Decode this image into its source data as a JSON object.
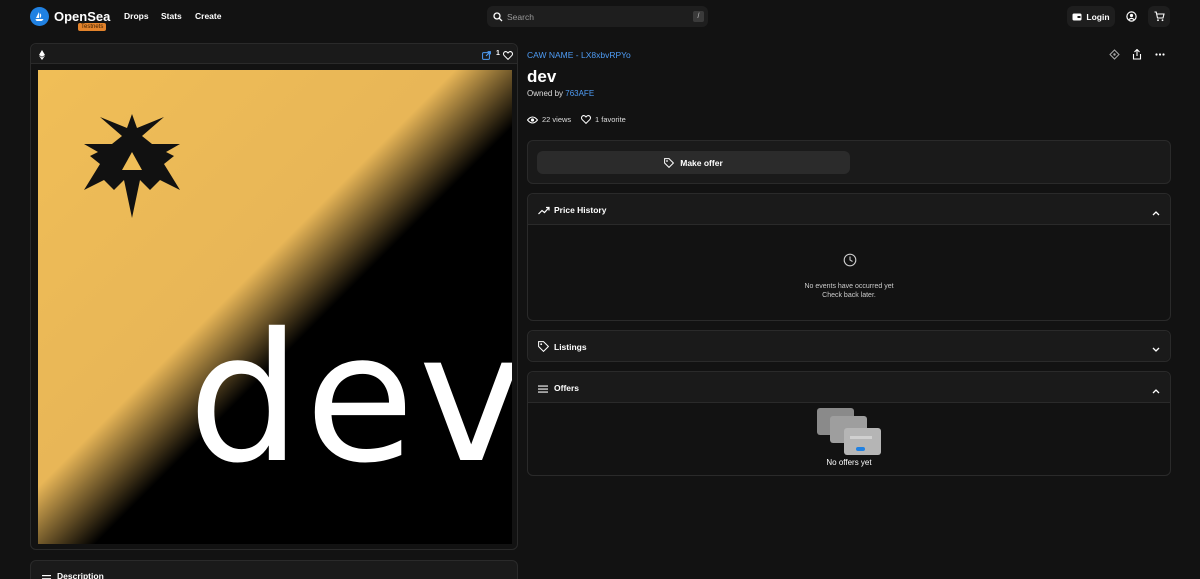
{
  "header": {
    "brand": "OpenSea",
    "badge": "Testnets",
    "nav": [
      "Drops",
      "Stats",
      "Create"
    ],
    "search_placeholder": "Search",
    "search_shortcut": "/",
    "login_label": "Login"
  },
  "media": {
    "favorite_count": "1",
    "art_text": "dev"
  },
  "description": {
    "label": "Description"
  },
  "item": {
    "collection": "CAW NAME - LX8xbvRPYo",
    "name": "dev",
    "owned_by_prefix": "Owned by ",
    "owner": "763AFE",
    "views": "22 views",
    "favorites": "1 favorite"
  },
  "actions": {
    "make_offer": "Make offer"
  },
  "price_history": {
    "label": "Price History",
    "empty_line1": "No events have occurred yet",
    "empty_line2": "Check back later."
  },
  "listings": {
    "label": "Listings"
  },
  "offers": {
    "label": "Offers",
    "empty": "No offers yet"
  },
  "colors": {
    "accent": "#2081e2",
    "link": "#4e9cf5",
    "art_yellow": "#f0be57",
    "badge": "#e2832b"
  }
}
